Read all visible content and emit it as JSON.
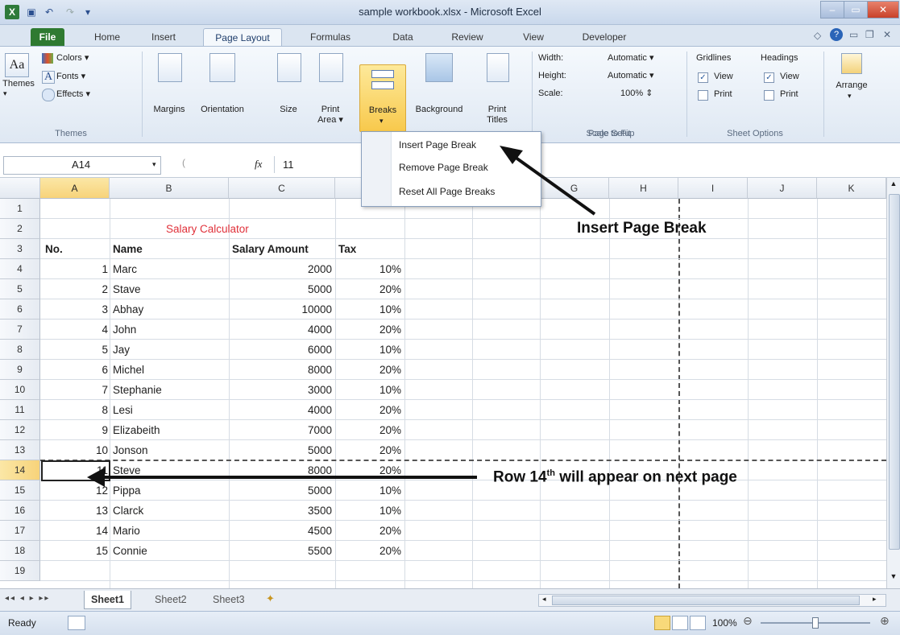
{
  "window": {
    "title": "sample workbook.xlsx - Microsoft Excel"
  },
  "tabs": [
    "File",
    "Home",
    "Insert",
    "Page Layout",
    "Formulas",
    "Data",
    "Review",
    "View",
    "Developer"
  ],
  "ribbon": {
    "themes": {
      "themes_label": "Themes",
      "colors": "Colors",
      "fonts": "Fonts",
      "effects": "Effects",
      "group": "Themes"
    },
    "page_setup": {
      "margins": "Margins",
      "orientation": "Orientation",
      "size": "Size",
      "print_area_1": "Print",
      "print_area_2": "Area",
      "breaks": "Breaks",
      "background": "Background",
      "print_titles_1": "Print",
      "print_titles_2": "Titles",
      "group": "Page Setup"
    },
    "scale_to_fit": {
      "width_label": "Width:",
      "width_value": "Automatic",
      "height_label": "Height:",
      "height_value": "Automatic",
      "scale_label": "Scale:",
      "scale_value": "100%",
      "group": "Scale to Fit"
    },
    "sheet_options": {
      "gridlines": "Gridlines",
      "headings": "Headings",
      "view": "View",
      "print": "Print",
      "group": "Sheet Options"
    },
    "arrange": "Arrange"
  },
  "breaks_menu": [
    "Insert Page Break",
    "Remove Page Break",
    "Reset All Page Breaks"
  ],
  "formula_bar": {
    "name_box": "A14",
    "fx": "fx",
    "value": "11"
  },
  "columns": [
    "A",
    "B",
    "C",
    "D",
    "E",
    "F",
    "G",
    "H",
    "I",
    "J",
    "K"
  ],
  "rows": [
    "1",
    "2",
    "3",
    "4",
    "5",
    "6",
    "7",
    "8",
    "9",
    "10",
    "11",
    "12",
    "13",
    "14",
    "15",
    "16",
    "17",
    "18",
    "19"
  ],
  "sheet": {
    "title": "Salary Calculator",
    "headers": {
      "no": "No.",
      "name": "Name",
      "salary": "Salary Amount",
      "tax": "Tax"
    },
    "records": [
      {
        "no": "1",
        "name": "Marc",
        "salary": "2000",
        "tax": "10%"
      },
      {
        "no": "2",
        "name": "Stave",
        "salary": "5000",
        "tax": "20%"
      },
      {
        "no": "3",
        "name": "Abhay",
        "salary": "10000",
        "tax": "10%"
      },
      {
        "no": "4",
        "name": "John",
        "salary": "4000",
        "tax": "20%"
      },
      {
        "no": "5",
        "name": "Jay",
        "salary": "6000",
        "tax": "10%"
      },
      {
        "no": "6",
        "name": "Michel",
        "salary": "8000",
        "tax": "20%"
      },
      {
        "no": "7",
        "name": "Stephanie",
        "salary": "3000",
        "tax": "10%"
      },
      {
        "no": "8",
        "name": "Lesi",
        "salary": "4000",
        "tax": "20%"
      },
      {
        "no": "9",
        "name": "Elizabeith",
        "salary": "7000",
        "tax": "20%"
      },
      {
        "no": "10",
        "name": "Jonson",
        "salary": "5000",
        "tax": "20%"
      },
      {
        "no": "11",
        "name": "Steve",
        "salary": "8000",
        "tax": "20%"
      },
      {
        "no": "12",
        "name": "Pippa",
        "salary": "5000",
        "tax": "10%"
      },
      {
        "no": "13",
        "name": "Clarck",
        "salary": "3500",
        "tax": "10%"
      },
      {
        "no": "14",
        "name": "Mario",
        "salary": "4500",
        "tax": "20%"
      },
      {
        "no": "15",
        "name": "Connie",
        "salary": "5500",
        "tax": "20%"
      }
    ]
  },
  "annotations": {
    "insert_page_break": "Insert Page Break",
    "row14_a": "Row 14",
    "row14_sup": "th",
    "row14_b": " will appear on next page"
  },
  "sheet_tabs": [
    "Sheet1",
    "Sheet2",
    "Sheet3"
  ],
  "status": {
    "ready": "Ready",
    "zoom": "100%"
  },
  "colors": {
    "accent_title": "#e0313a",
    "file_tab": "#2f7a31",
    "selection": "#f7d37a"
  }
}
